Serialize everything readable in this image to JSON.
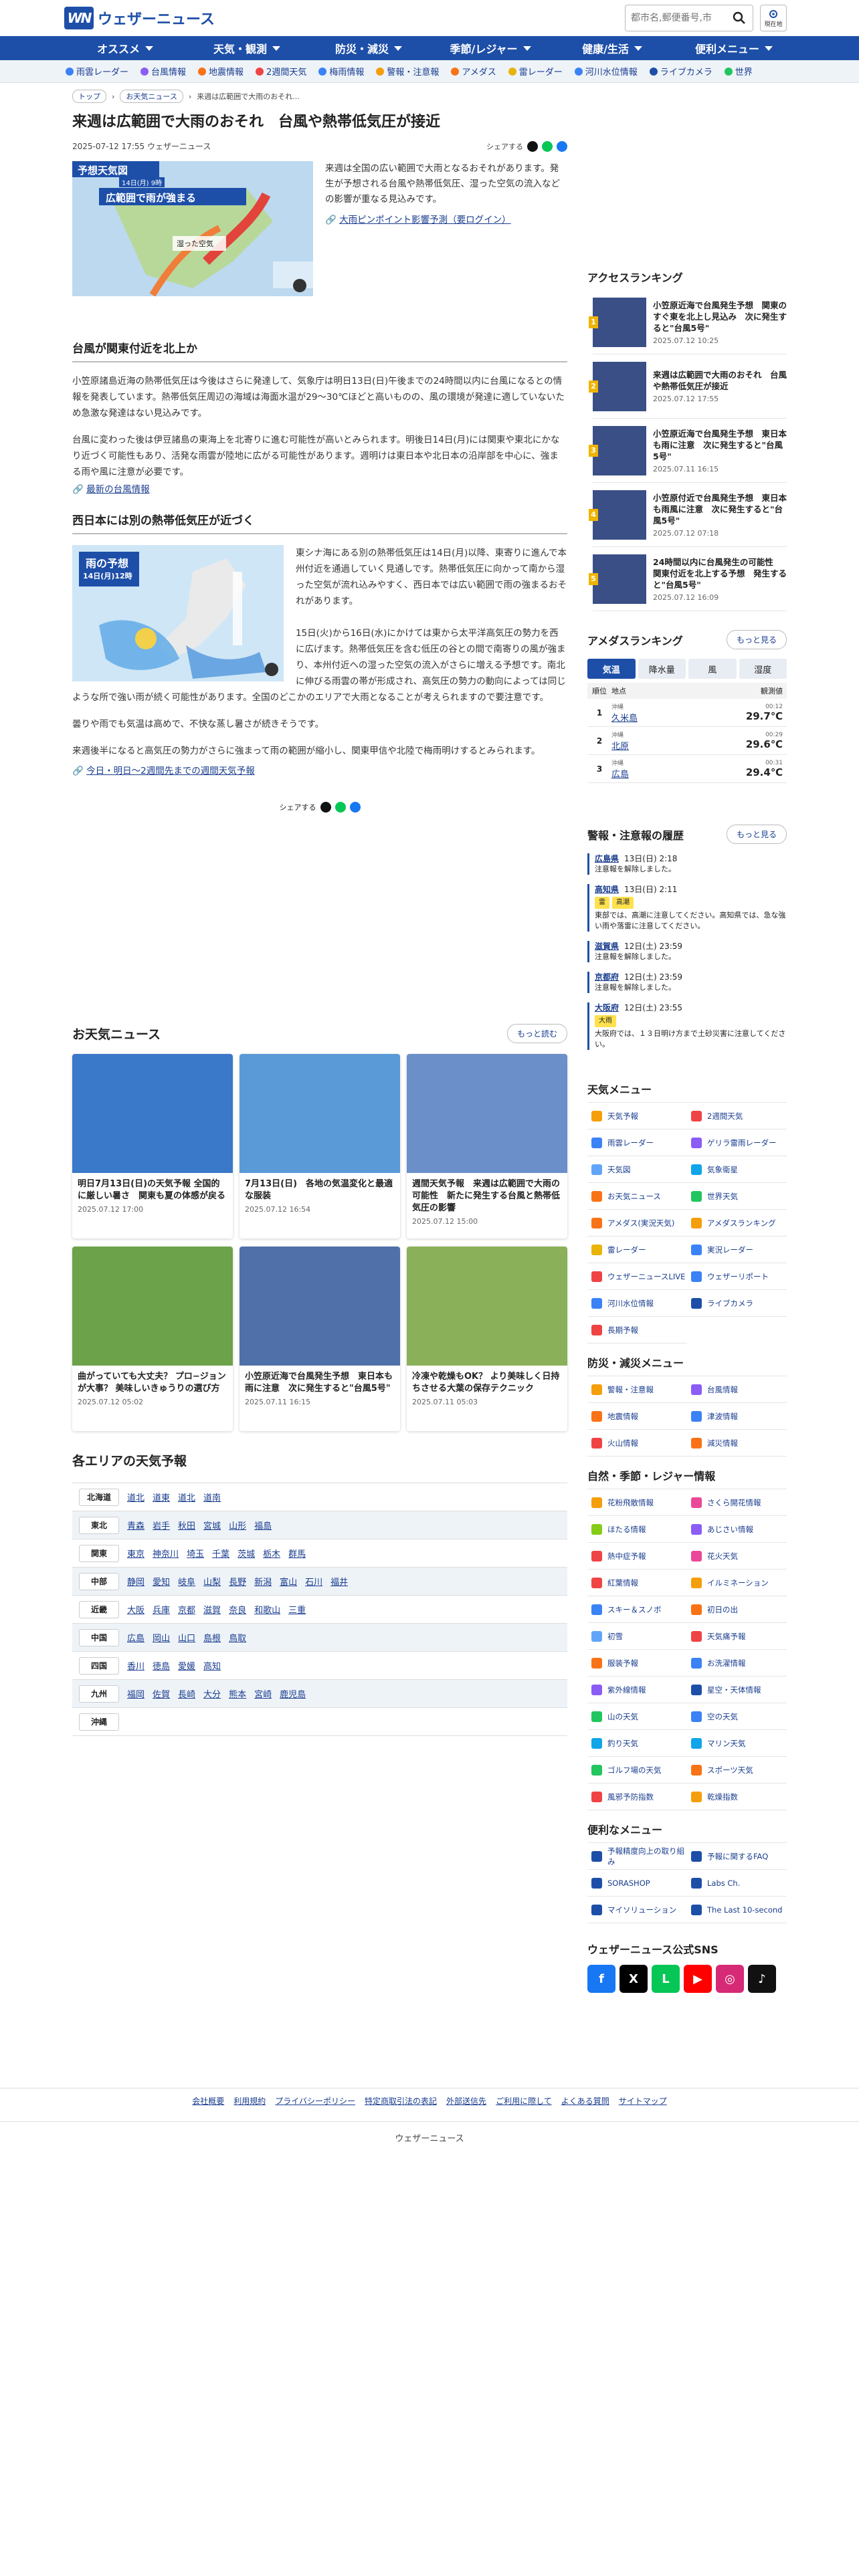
{
  "header": {
    "logo_mark": "WN",
    "logo_text": "ウェザーニュース",
    "search_placeholder": "都市名,郵便番号,市",
    "loc_label": "現在地"
  },
  "gnav": [
    "オススメ",
    "天気・観測",
    "防災・減災",
    "季節/レジャー",
    "健康/生活",
    "便利メニュー"
  ],
  "subnav": [
    {
      "label": "雨雲レーダー",
      "color": "#3b82f6"
    },
    {
      "label": "台風情報",
      "color": "#8b5cf6"
    },
    {
      "label": "地震情報",
      "color": "#f97316"
    },
    {
      "label": "2週間天気",
      "color": "#ef4444"
    },
    {
      "label": "梅雨情報",
      "color": "#3b82f6"
    },
    {
      "label": "警報・注意報",
      "color": "#f59e0b"
    },
    {
      "label": "アメダス",
      "color": "#f97316"
    },
    {
      "label": "雷レーダー",
      "color": "#eab308"
    },
    {
      "label": "河川水位情報",
      "color": "#3b82f6"
    },
    {
      "label": "ライブカメラ",
      "color": "#1d4fa8"
    },
    {
      "label": "世界",
      "color": "#22c55e"
    }
  ],
  "breadcrumb": [
    "トップ",
    "お天気ニュース",
    "来週は広範囲で大雨のおそれ..."
  ],
  "article": {
    "title": "来週は広範囲で大雨のおそれ　台風や熱帯低気圧が接近",
    "date": "2025-07-12 17:55 ウェザーニュース",
    "share_label": "シェアする",
    "lead_img_title": "予想天気図",
    "lead_img_date": "14日(月) 9時",
    "lead_img_banner": "広範囲で雨が強まる",
    "lead_img_label": "湿った空気",
    "lead": "来週は全国の広い範囲で大雨となるおそれがあります。発生が予想される台風や熱帯低気圧、湿った空気の流入などの影響が重なる見込みです。",
    "lead_link": "大雨ピンポイント影響予測（要ログイン）",
    "h2a": "台風が関東付近を北上か",
    "p1": "小笠原諸島近海の熱帯低気圧は今後はさらに発達して、気象庁は明日13日(日)午後までの24時間以内に台風になるとの情報を発表しています。熱帯低気圧周辺の海域は海面水温が29～30℃ほどと高いものの、風の環境が発達に適していないため急激な発達はない見込みです。",
    "p2": "台風に変わった後は伊豆諸島の東海上を北寄りに進む可能性が高いとみられます。明後日14日(月)には関東や東北にかなり近づく可能性もあり、活発な雨雲が陸地に広がる可能性があります。週明けは東日本や北日本の沿岸部を中心に、強まる雨や風に注意が必要です。",
    "link2": "最新の台風情報",
    "h2b": "西日本には別の熱帯低気圧が近づく",
    "map_title": "雨の予想",
    "map_date": "14日(月)12時",
    "p3": "東シナ海にある別の熱帯低気圧は14日(月)以降、東寄りに進んで本州付近を通過していく見通しです。熱帯低気圧に向かって南から湿った空気が流れ込みやすく、西日本では広い範囲で雨の強まるおそれがあります。",
    "p4": "15日(火)から16日(水)にかけては東から太平洋高気圧の勢力を西に広げます。熱帯低気圧を含む低圧の谷との間で南寄りの風が強まり、本州付近への湿った空気の流入がさらに増える予想です。南北に伸びる雨雲の帯が形成され、高気圧の勢力の動向によっては同じような所で強い雨が続く可能性があります。全国のどこかのエリアで大雨となることが考えられますので要注意です。",
    "p5": "曇りや雨でも気温は高めで、不快な蒸し暑さが続きそうです。",
    "p6": "来週後半になると高気圧の勢力がさらに強まって雨の範囲が縮小し、関東甲信や北陸で梅雨明けするとみられます。",
    "link3": "今日・明日～2週間先までの週間天気予報"
  },
  "news": {
    "title": "お天気ニュース",
    "more": "もっと読む",
    "items": [
      {
        "title": "明日7月13日(日)の天気予報 全国的に厳しい暑さ　関東も夏の体感が戻る",
        "date": "2025.07.12 17:00",
        "color": "#3a78c9"
      },
      {
        "title": "7月13日(日)　各地の気温変化と最適な服装",
        "date": "2025.07.12 16:54",
        "color": "#5a9ad6"
      },
      {
        "title": "週間天気予報　来週は広範囲で大雨の可能性　新たに発生する台風と熱帯低気圧の影響",
        "date": "2025.07.12 15:00",
        "color": "#6b8fc9"
      },
      {
        "title": "曲がっていても大丈夫？ プロ−ジョンが大事？ 美味しいきゅうりの選び方",
        "date": "2025.07.12 05:02",
        "color": "#6ca24a"
      },
      {
        "title": "小笠原近海で台風発生予想　東日本も雨に注意　次に発生すると\"台風5号\"",
        "date": "2025.07.11 16:15",
        "color": "#4f70a8"
      },
      {
        "title": "冷凍や乾燥もOK？ より美味しく日持ちさせる大葉の保存テクニック",
        "date": "2025.07.11 05:03",
        "color": "#8bb05a"
      }
    ]
  },
  "areas": {
    "title": "各エリアの天気予報",
    "rows": [
      {
        "region": "北海道",
        "prefs": [
          "道北",
          "道東",
          "道北",
          "道南"
        ]
      },
      {
        "region": "東北",
        "prefs": [
          "青森",
          "岩手",
          "秋田",
          "宮城",
          "山形",
          "福島"
        ]
      },
      {
        "region": "関東",
        "prefs": [
          "東京",
          "神奈川",
          "埼玉",
          "千葉",
          "茨城",
          "栃木",
          "群馬"
        ]
      },
      {
        "region": "中部",
        "prefs": [
          "静岡",
          "愛知",
          "岐阜",
          "山梨",
          "長野",
          "新潟",
          "富山",
          "石川",
          "福井"
        ]
      },
      {
        "region": "近畿",
        "prefs": [
          "大阪",
          "兵庫",
          "京都",
          "滋賀",
          "奈良",
          "和歌山",
          "三重"
        ]
      },
      {
        "region": "中国",
        "prefs": [
          "広島",
          "岡山",
          "山口",
          "島根",
          "鳥取"
        ]
      },
      {
        "region": "四国",
        "prefs": [
          "香川",
          "徳島",
          "愛媛",
          "高知"
        ]
      },
      {
        "region": "九州",
        "prefs": [
          "福岡",
          "佐賀",
          "長崎",
          "大分",
          "熊本",
          "宮崎",
          "鹿児島"
        ]
      },
      {
        "region": "沖縄",
        "prefs": []
      }
    ]
  },
  "access": {
    "title": "アクセスランキング",
    "items": [
      {
        "title": "小笠原近海で台風発生予想　関東のすぐ東を北上し見込み　次に発生すると\"台風5号\"",
        "date": "2025.07.12 10:25"
      },
      {
        "title": "来週は広範囲で大雨のおそれ　台風や熱帯低気圧が接近",
        "date": "2025.07.12 17:55"
      },
      {
        "title": "小笠原近海で台風発生予想　東日本も雨に注意　次に発生すると\"台風5号\"",
        "date": "2025.07.11 16:15"
      },
      {
        "title": "小笠原付近で台風発生予想　東日本も雨風に注意　次に発生すると\"台風5号\"",
        "date": "2025.07.12 07:18"
      },
      {
        "title": "24時間以内に台風発生の可能性　関東付近を北上する予想　発生すると\"台風5号\"",
        "date": "2025.07.12 16:09"
      }
    ]
  },
  "amedas": {
    "title": "アメダスランキング",
    "more": "もっと見る",
    "tabs": [
      "気温",
      "降水量",
      "風",
      "湿度"
    ],
    "head": [
      "順位",
      "地点",
      "観測値"
    ],
    "rows": [
      {
        "rank": "1",
        "pref": "沖縄",
        "place": "久米島",
        "time": "00:12",
        "value": "29.7℃"
      },
      {
        "rank": "2",
        "pref": "沖縄",
        "place": "北原",
        "time": "00:29",
        "value": "29.6℃"
      },
      {
        "rank": "3",
        "pref": "沖縄",
        "place": "広島",
        "time": "00:31",
        "value": "29.4℃"
      }
    ]
  },
  "warnings": {
    "title": "警報・注意報の履歴",
    "more": "もっと見る",
    "items": [
      {
        "place": "広島県",
        "time": "13日(日) 2:18",
        "tags": [],
        "text": "注意報を解除しました。"
      },
      {
        "place": "高知県",
        "time": "13日(日) 2:11",
        "tags": [
          "雷",
          "高潮"
        ],
        "text": "東部では、高潮に注意してください。高知県では、急な強い雨や落雷に注意してください。"
      },
      {
        "place": "滋賀県",
        "time": "12日(土) 23:59",
        "tags": [],
        "text": "注意報を解除しました。"
      },
      {
        "place": "京都府",
        "time": "12日(土) 23:59",
        "tags": [],
        "text": "注意報を解除しました。"
      },
      {
        "place": "大阪府",
        "time": "12日(土) 23:55",
        "tags": [
          "大雨"
        ],
        "text": "大阪府では、１３日明け方まで土砂災害に注意してください。"
      }
    ]
  },
  "tenki_menu": {
    "title": "天気メニュー",
    "items": [
      {
        "label": "天気予報",
        "color": "#f59e0b"
      },
      {
        "label": "2週間天気",
        "color": "#ef4444"
      },
      {
        "label": "雨雲レーダー",
        "color": "#3b82f6"
      },
      {
        "label": "ゲリラ雷雨レーダー",
        "color": "#8b5cf6"
      },
      {
        "label": "天気図",
        "color": "#60a5fa"
      },
      {
        "label": "気象衛星",
        "color": "#0ea5e9"
      },
      {
        "label": "お天気ニュース",
        "color": "#f97316"
      },
      {
        "label": "世界天気",
        "color": "#22c55e"
      },
      {
        "label": "アメダス(実況天気)",
        "color": "#f97316"
      },
      {
        "label": "アメダスランキング",
        "color": "#f59e0b"
      },
      {
        "label": "雷レーダー",
        "color": "#eab308"
      },
      {
        "label": "実況レーダー",
        "color": "#3b82f6"
      },
      {
        "label": "ウェザーニュースLIVE",
        "color": "#ef4444"
      },
      {
        "label": "ウェザーリポート",
        "color": "#3b82f6"
      },
      {
        "label": "河川水位情報",
        "color": "#3b82f6"
      },
      {
        "label": "ライブカメラ",
        "color": "#1d4fa8"
      },
      {
        "label": "長期予報",
        "color": "#ef4444"
      }
    ]
  },
  "bousai_menu": {
    "title": "防災・減災メニュー",
    "items": [
      {
        "label": "警報・注意報",
        "color": "#f59e0b"
      },
      {
        "label": "台風情報",
        "color": "#8b5cf6"
      },
      {
        "label": "地震情報",
        "color": "#f97316"
      },
      {
        "label": "津波情報",
        "color": "#3b82f6"
      },
      {
        "label": "火山情報",
        "color": "#ef4444"
      },
      {
        "label": "減災情報",
        "color": "#f97316"
      }
    ]
  },
  "season_menu": {
    "title": "自然・季節・レジャー情報",
    "items": [
      {
        "label": "花粉飛散情報",
        "color": "#f59e0b"
      },
      {
        "label": "さくら開花情報",
        "color": "#ec4899"
      },
      {
        "label": "ほたる情報",
        "color": "#84cc16"
      },
      {
        "label": "あじさい情報",
        "color": "#8b5cf6"
      },
      {
        "label": "熱中症予報",
        "color": "#ef4444"
      },
      {
        "label": "花火天気",
        "color": "#ec4899"
      },
      {
        "label": "紅葉情報",
        "color": "#ef4444"
      },
      {
        "label": "イルミネーション",
        "color": "#f59e0b"
      },
      {
        "label": "スキー＆スノボ",
        "color": "#3b82f6"
      },
      {
        "label": "初日の出",
        "color": "#f97316"
      },
      {
        "label": "初雪",
        "color": "#60a5fa"
      },
      {
        "label": "天気痛予報",
        "color": "#ef4444"
      },
      {
        "label": "服装予報",
        "color": "#f97316"
      },
      {
        "label": "お洗濯情報",
        "color": "#3b82f6"
      },
      {
        "label": "紫外線情報",
        "color": "#8b5cf6"
      },
      {
        "label": "星空・天体情報",
        "color": "#1d4fa8"
      },
      {
        "label": "山の天気",
        "color": "#22c55e"
      },
      {
        "label": "空の天気",
        "color": "#3b82f6"
      },
      {
        "label": "釣り天気",
        "color": "#0ea5e9"
      },
      {
        "label": "マリン天気",
        "color": "#0ea5e9"
      },
      {
        "label": "ゴルフ場の天気",
        "color": "#22c55e"
      },
      {
        "label": "スポーツ天気",
        "color": "#f97316"
      },
      {
        "label": "風邪予防指数",
        "color": "#ef4444"
      },
      {
        "label": "乾燥指数",
        "color": "#f59e0b"
      }
    ]
  },
  "benri_menu": {
    "title": "便利なメニュー",
    "items": [
      {
        "label": "予報精度向上の取り組み",
        "color": "#1d4fa8"
      },
      {
        "label": "予報に関するFAQ",
        "color": "#1d4fa8"
      },
      {
        "label": "SORASHOP",
        "color": "#1d4fa8"
      },
      {
        "label": "Labs Ch.",
        "color": "#1d4fa8"
      },
      {
        "label": "マイソリューション",
        "color": "#1d4fa8"
      },
      {
        "label": "The Last 10-second",
        "color": "#1d4fa8"
      }
    ]
  },
  "sns": {
    "title": "ウェザーニュース公式SNS",
    "items": [
      {
        "label": "f",
        "color": "#1877f2",
        "name": "facebook-icon"
      },
      {
        "label": "X",
        "color": "#000000",
        "name": "x-icon"
      },
      {
        "label": "L",
        "color": "#06c755",
        "name": "line-icon"
      },
      {
        "label": "▶",
        "color": "#ff0000",
        "name": "youtube-icon"
      },
      {
        "label": "◎",
        "color": "#d62976",
        "name": "instagram-icon"
      },
      {
        "label": "♪",
        "color": "#111111",
        "name": "tiktok-icon"
      }
    ]
  },
  "footer": {
    "links": [
      "会社概要",
      "利用規約",
      "プライバシーポリシー",
      "特定商取引法の表記",
      "外部送信先",
      "ご利用に際して",
      "よくある質問",
      "サイトマップ"
    ],
    "copy": "ウェザーニュース"
  }
}
